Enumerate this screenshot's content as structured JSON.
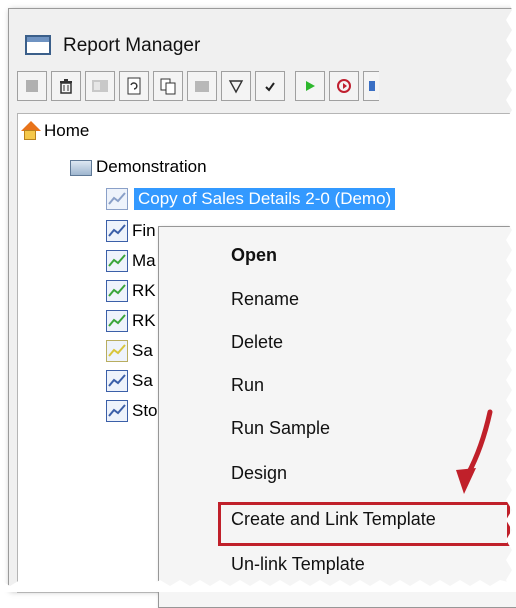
{
  "window": {
    "title": "Report Manager"
  },
  "toolbar": {
    "buttons": [
      {
        "icon": "new-icon",
        "enabled": false
      },
      {
        "icon": "delete-icon",
        "enabled": true
      },
      {
        "icon": "properties-icon",
        "enabled": false
      },
      {
        "icon": "refresh-icon",
        "enabled": true
      },
      {
        "icon": "copy-icon",
        "enabled": true
      },
      {
        "icon": "paste-icon",
        "enabled": false
      },
      {
        "icon": "filter-icon",
        "enabled": true
      },
      {
        "icon": "check-icon",
        "enabled": true
      },
      {
        "icon": "run-icon",
        "enabled": true
      },
      {
        "icon": "schedule-icon",
        "enabled": true
      }
    ]
  },
  "tree": {
    "home": "Home",
    "folder": "Demonstration",
    "selected_report": "Copy of Sales Details 2-0 (Demo)",
    "reports": [
      {
        "label": "Fin",
        "icon_color": "#3b5fa8"
      },
      {
        "label": "Ma",
        "icon_color": "#3aa53a"
      },
      {
        "label": "RK",
        "icon_color": "#3aa53a"
      },
      {
        "label": "RK",
        "icon_color": "#3aa53a"
      },
      {
        "label": "Sa",
        "icon_color": "#d8c53a"
      },
      {
        "label": "Sa",
        "icon_color": "#3b5fa8"
      },
      {
        "label": "Sto",
        "icon_color": "#3b5fa8"
      }
    ]
  },
  "context_menu": {
    "items": [
      {
        "label": "Open",
        "bold": true
      },
      {
        "label": "Rename",
        "bold": false
      },
      {
        "label": "Delete",
        "bold": false
      },
      {
        "label": "Run",
        "bold": false
      },
      {
        "label": "Run Sample",
        "bold": false
      },
      {
        "label": "Design",
        "bold": false
      },
      {
        "label": "Create and Link Template",
        "bold": false,
        "highlighted": true
      },
      {
        "label": "Un-link Template",
        "bold": false
      }
    ]
  },
  "colors": {
    "selection": "#3399ff",
    "highlight_box": "#c0202a",
    "arrow": "#c0202a"
  }
}
